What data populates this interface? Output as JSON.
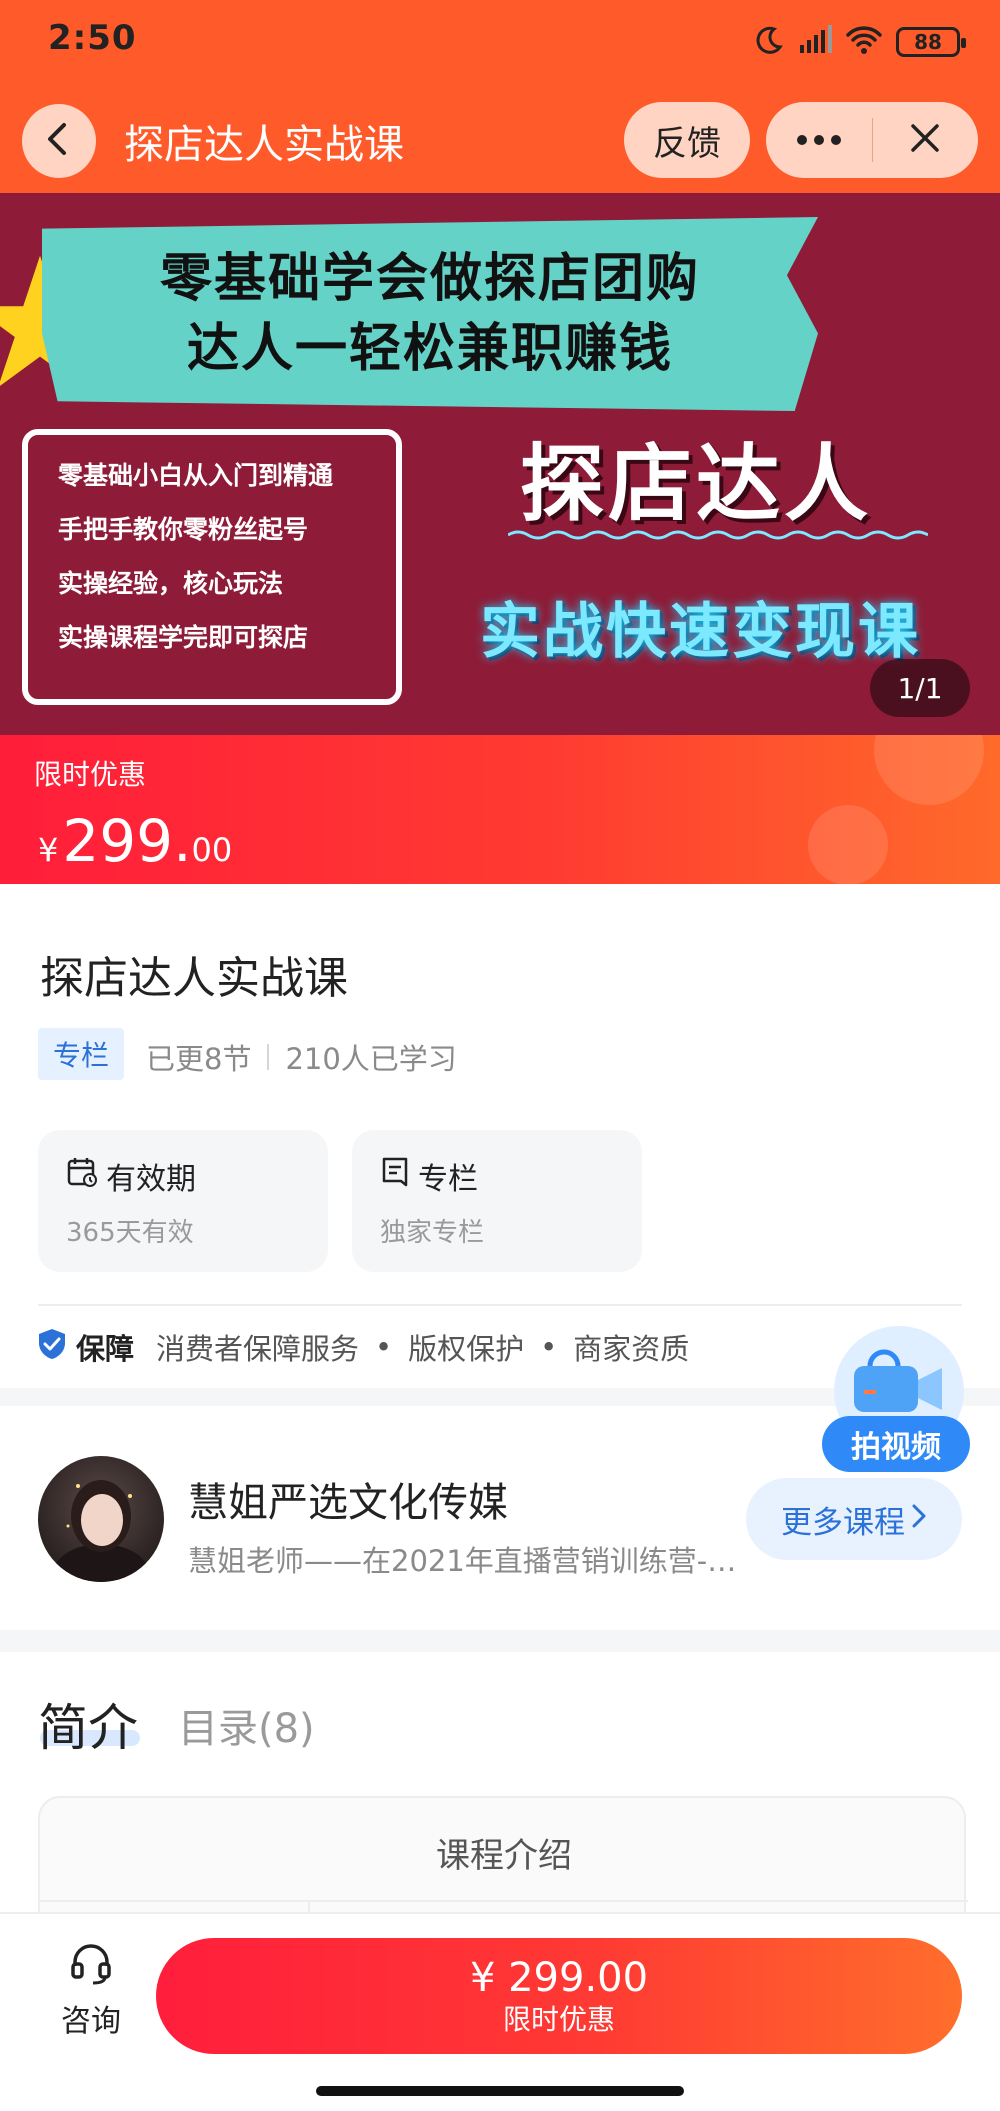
{
  "status_bar": {
    "time": "2:50",
    "battery": "88"
  },
  "nav": {
    "title": "探店达人实战课",
    "feedback_label": "反馈"
  },
  "banner": {
    "headline_lines": [
      "零基础学会做探店团购",
      "达人一轻松兼职赚钱"
    ],
    "points": [
      "零基础小白从入门到精通",
      "手把手教你零粉丝起号",
      "实操经验，核心玩法",
      "实操课程学完即可探店"
    ],
    "big_title": "探店达人",
    "sub_title": "实战快速变现课",
    "counter": "1/1"
  },
  "price": {
    "label": "限时优惠",
    "currency": "¥",
    "integer": "299.",
    "decimal": "00"
  },
  "course": {
    "title": "探店达人实战课",
    "tag": "专栏",
    "updated": "已更8节",
    "learners": "210人已学习",
    "cards": [
      {
        "title": "有效期",
        "sub": "365天有效",
        "icon": "calendar-icon"
      },
      {
        "title": "专栏",
        "sub": "独家专栏",
        "icon": "column-icon"
      }
    ]
  },
  "guarantee": {
    "title": "保障",
    "items": [
      "消费者保障服务",
      "版权保护",
      "商家资质"
    ]
  },
  "float_video": {
    "label": "拍视频"
  },
  "author": {
    "name": "慧姐严选文化传媒",
    "desc": "慧姐老师——在2021年直播营销训练营-…",
    "more_label": "更多课程"
  },
  "tabs": {
    "intro": "简介",
    "catalog": "目录(8)"
  },
  "intro_box": {
    "title": "课程介绍"
  },
  "bottom": {
    "consult_label": "咨询",
    "buy_price": "¥ 299.00",
    "buy_sub": "限时优惠"
  },
  "colors": {
    "brand_orange": "#ff5a2a",
    "price_red": "#ff1d3a",
    "link_blue": "#2b71d8",
    "banner_bg": "#8e1b37"
  }
}
